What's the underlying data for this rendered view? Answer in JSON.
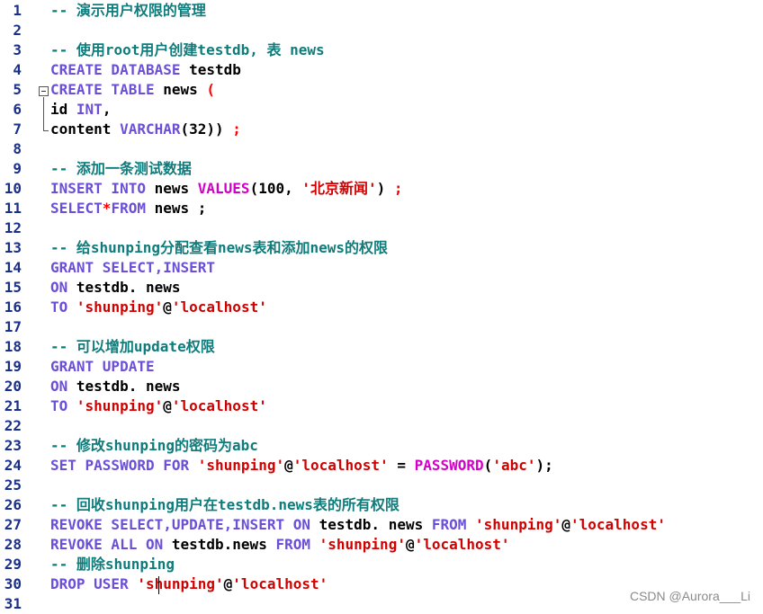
{
  "editor": {
    "watermark": "CSDN @Aurora___Li",
    "lines": [
      {
        "n": "1",
        "tokens": [
          {
            "t": "-- 演示用户权限的管理",
            "c": "cm"
          }
        ]
      },
      {
        "n": "2",
        "tokens": []
      },
      {
        "n": "3",
        "tokens": [
          {
            "t": "-- 使用root用户创建testdb, 表 news",
            "c": "cm"
          }
        ]
      },
      {
        "n": "4",
        "tokens": [
          {
            "t": "CREATE DATABASE ",
            "c": "kw"
          },
          {
            "t": "testdb",
            "c": "tx"
          }
        ]
      },
      {
        "n": "5",
        "tokens": [
          {
            "t": "CREATE TABLE ",
            "c": "kw"
          },
          {
            "t": "news ",
            "c": "tx"
          },
          {
            "t": "(",
            "c": "sym"
          }
        ]
      },
      {
        "n": "6",
        "tokens": [
          {
            "t": "id ",
            "c": "tx"
          },
          {
            "t": "INT",
            "c": "kw"
          },
          {
            "t": ",",
            "c": "tx"
          }
        ]
      },
      {
        "n": "7",
        "tokens": [
          {
            "t": "content ",
            "c": "tx"
          },
          {
            "t": "VARCHAR",
            "c": "kw"
          },
          {
            "t": "(32)) ",
            "c": "tx"
          },
          {
            "t": ";",
            "c": "sym"
          }
        ]
      },
      {
        "n": "8",
        "tokens": []
      },
      {
        "n": "9",
        "tokens": [
          {
            "t": "-- 添加一条测试数据",
            "c": "cm"
          }
        ]
      },
      {
        "n": "10",
        "tokens": [
          {
            "t": "INSERT INTO ",
            "c": "kw"
          },
          {
            "t": "news ",
            "c": "tx"
          },
          {
            "t": "VALUES",
            "c": "fn"
          },
          {
            "t": "(100, ",
            "c": "tx"
          },
          {
            "t": "'北京新闻'",
            "c": "str"
          },
          {
            "t": ") ",
            "c": "tx"
          },
          {
            "t": ";",
            "c": "sym"
          }
        ]
      },
      {
        "n": "11",
        "tokens": [
          {
            "t": "SELECT",
            "c": "kw"
          },
          {
            "t": "*",
            "c": "sym"
          },
          {
            "t": "FROM ",
            "c": "kw"
          },
          {
            "t": "news ",
            "c": "tx"
          },
          {
            "t": ";",
            "c": "tx"
          }
        ]
      },
      {
        "n": "12",
        "tokens": []
      },
      {
        "n": "13",
        "tokens": [
          {
            "t": "-- 给shunping分配查看news表和添加news的权限",
            "c": "cm"
          }
        ]
      },
      {
        "n": "14",
        "tokens": [
          {
            "t": "GRANT SELECT,INSERT",
            "c": "kw"
          }
        ]
      },
      {
        "n": "15",
        "tokens": [
          {
            "t": "ON ",
            "c": "kw"
          },
          {
            "t": "testdb. news",
            "c": "tx"
          }
        ]
      },
      {
        "n": "16",
        "tokens": [
          {
            "t": "TO ",
            "c": "kw"
          },
          {
            "t": "'shunping'",
            "c": "str"
          },
          {
            "t": "@",
            "c": "tx"
          },
          {
            "t": "'localhost'",
            "c": "str"
          }
        ]
      },
      {
        "n": "17",
        "tokens": []
      },
      {
        "n": "18",
        "tokens": [
          {
            "t": "-- 可以增加update权限",
            "c": "cm"
          }
        ]
      },
      {
        "n": "19",
        "tokens": [
          {
            "t": "GRANT UPDATE",
            "c": "kw"
          }
        ]
      },
      {
        "n": "20",
        "tokens": [
          {
            "t": "ON ",
            "c": "kw"
          },
          {
            "t": "testdb. news",
            "c": "tx"
          }
        ]
      },
      {
        "n": "21",
        "tokens": [
          {
            "t": "TO ",
            "c": "kw"
          },
          {
            "t": "'shunping'",
            "c": "str"
          },
          {
            "t": "@",
            "c": "tx"
          },
          {
            "t": "'localhost'",
            "c": "str"
          }
        ]
      },
      {
        "n": "22",
        "tokens": []
      },
      {
        "n": "23",
        "tokens": [
          {
            "t": "-- 修改shunping的密码为abc",
            "c": "cm"
          }
        ]
      },
      {
        "n": "24",
        "tokens": [
          {
            "t": "SET PASSWORD FOR ",
            "c": "kw"
          },
          {
            "t": "'shunping'",
            "c": "str"
          },
          {
            "t": "@",
            "c": "tx"
          },
          {
            "t": "'localhost'",
            "c": "str"
          },
          {
            "t": " = ",
            "c": "tx"
          },
          {
            "t": "PASSWORD",
            "c": "fn"
          },
          {
            "t": "(",
            "c": "tx"
          },
          {
            "t": "'abc'",
            "c": "str"
          },
          {
            "t": ");",
            "c": "tx"
          }
        ]
      },
      {
        "n": "25",
        "tokens": []
      },
      {
        "n": "26",
        "tokens": [
          {
            "t": "-- 回收shunping用户在testdb.news表的所有权限",
            "c": "cm"
          }
        ]
      },
      {
        "n": "27",
        "tokens": [
          {
            "t": "REVOKE SELECT,UPDATE,INSERT ON ",
            "c": "kw"
          },
          {
            "t": "testdb. news ",
            "c": "tx"
          },
          {
            "t": "FROM ",
            "c": "kw"
          },
          {
            "t": "'shunping'",
            "c": "str"
          },
          {
            "t": "@",
            "c": "tx"
          },
          {
            "t": "'localhost'",
            "c": "str"
          }
        ]
      },
      {
        "n": "28",
        "tokens": [
          {
            "t": "REVOKE ALL ON ",
            "c": "kw"
          },
          {
            "t": "testdb.news ",
            "c": "tx"
          },
          {
            "t": "FROM ",
            "c": "kw"
          },
          {
            "t": "'shunping'",
            "c": "str"
          },
          {
            "t": "@",
            "c": "tx"
          },
          {
            "t": "'localhost'",
            "c": "str"
          }
        ]
      },
      {
        "n": "29",
        "tokens": [
          {
            "t": "-- 删除shunping",
            "c": "cm"
          }
        ]
      },
      {
        "n": "30",
        "tokens": [
          {
            "t": "DROP USER ",
            "c": "kw"
          },
          {
            "t": "'shunping'",
            "c": "str"
          },
          {
            "t": "@",
            "c": "tx"
          },
          {
            "t": "'localhost'",
            "c": "str"
          }
        ]
      },
      {
        "n": "31",
        "tokens": []
      }
    ]
  }
}
